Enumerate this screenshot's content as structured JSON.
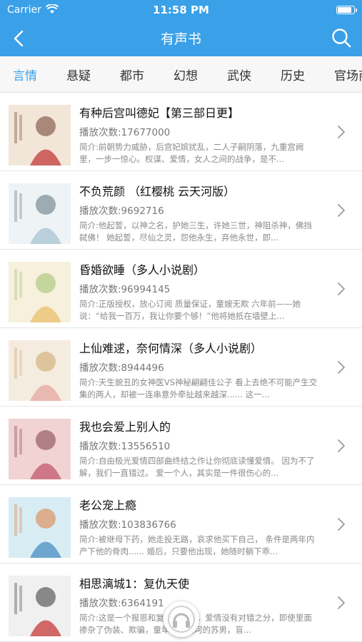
{
  "status_bar": {
    "carrier": "Carrier",
    "time": "11:58 PM",
    "battery_level": 0.9
  },
  "navbar": {
    "title": "有声书",
    "back_icon": "back-arrow-icon",
    "search_icon": "search-icon"
  },
  "tabs": [
    {
      "label": "言情",
      "active": true
    },
    {
      "label": "悬疑",
      "active": false
    },
    {
      "label": "都市",
      "active": false
    },
    {
      "label": "幻想",
      "active": false
    },
    {
      "label": "武侠",
      "active": false
    },
    {
      "label": "历史",
      "active": false
    },
    {
      "label": "官场商",
      "active": false
    }
  ],
  "books": [
    {
      "title": "有种后宫叫德妃【第三部日更】",
      "plays": "播放次数:17677000",
      "desc": "简介:前朝势力威胁，后宫妃嫔扰乱，二人子嗣阴落，九重宫阙里，一步一惊心。权谋、爱情，女人之间的战争，是不...",
      "cover_title": "有种后宫叫德妃"
    },
    {
      "title": "不负荒颜 （红樱桃 云天河版）",
      "plays": "播放次数:9692716",
      "desc": "简介:他起誓，以神之名，护她三生，许她三世，神阻杀神，佛挡弑佛！ 她起誓，尽仙之灵，怨他永生，弃他永世，即...",
      "cover_title": "不负荒颜"
    },
    {
      "title": "昏婚欲睡（多人小说剧）",
      "plays": "播放次数:96994145",
      "desc": "简介:正版授权，放心订阅 质量保证，童嫂无欺 六年前——她说：“给我一百万，我让你要个够！”他将她抵在墙壁上...",
      "cover_title": "昏婚欲睡"
    },
    {
      "title": "上仙难逑，奈何情深（多人小说剧）",
      "plays": "播放次数:8944496",
      "desc": "简介:天生貌丑的女神医VS神秘翩翩佳公子 看上去绝不可能产生交集的两人，却被一连串意外牵扯越来越深...... 这一...",
      "cover_title": "上仙难逑"
    },
    {
      "title": "我也会爱上别人的",
      "plays": "播放次数:13556510",
      "desc": "简介:自由极光爱情四部曲终结之作让你彻底读懂爱情。 因为不了解，我们一直错过。 爱一个人，其实是一件很伤心的...",
      "cover_title": ""
    },
    {
      "title": "老公宠上瘾",
      "plays": "播放次数:103836766",
      "desc": "简介:被继母下药，她走投无路，哀求他买下自己， 条件是两年内产下他的骨肉...... 婚后，只要他出现，她随时躺下乖...",
      "cover_title": "老公宠上瘾"
    },
    {
      "title": "相思漓城1：复仇天使",
      "plays": "播放次数:6364191",
      "desc": "简介:这是一个报恩和复仇的故事。爱情没有对错之分，即使里面掺杂了伪装、欺骗，童年经历坎坷的苏男，盲...",
      "cover_title": "复仇天使"
    }
  ],
  "colors": {
    "accent": "#3aa0e8",
    "header_text": "#ffffff",
    "muted_text": "#8a8a8a"
  },
  "fab_icon": "headphones-icon"
}
